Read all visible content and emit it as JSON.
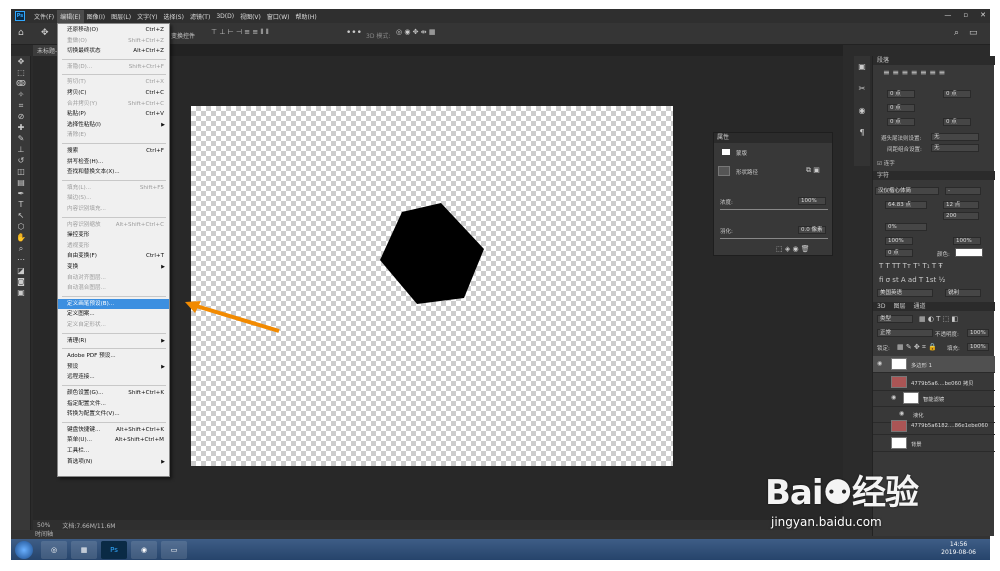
{
  "app": {
    "logo": "Ps"
  },
  "menu": [
    "文件(F)",
    "编辑(E)",
    "图像(I)",
    "图层(L)",
    "文字(Y)",
    "选择(S)",
    "滤镜(T)",
    "3D(D)",
    "视图(V)",
    "窗口(W)",
    "帮助(H)"
  ],
  "window_controls": [
    "—",
    "▫",
    "✕"
  ],
  "options_bar": {
    "label": "变换控件",
    "mode": "3D 模式:"
  },
  "doc_tab": {
    "title": "未标题-"
  },
  "status": {
    "zoom": "50%",
    "doc": "文档:7.66M/11.6M"
  },
  "timeline": {
    "label": "时间轴"
  },
  "edit_menu": [
    {
      "label": "还原移动(O)",
      "shortcut": "Ctrl+Z",
      "disabled": false
    },
    {
      "label": "重做(O)",
      "shortcut": "Shift+Ctrl+Z",
      "disabled": true
    },
    {
      "label": "切换最终状态",
      "shortcut": "Alt+Ctrl+Z",
      "disabled": false
    },
    {
      "sep": true
    },
    {
      "label": "渐隐(D)...",
      "shortcut": "Shift+Ctrl+F",
      "disabled": true
    },
    {
      "sep": true
    },
    {
      "label": "剪切(T)",
      "shortcut": "Ctrl+X",
      "disabled": true
    },
    {
      "label": "拷贝(C)",
      "shortcut": "Ctrl+C",
      "disabled": false
    },
    {
      "label": "合并拷贝(Y)",
      "shortcut": "Shift+Ctrl+C",
      "disabled": true
    },
    {
      "label": "粘贴(P)",
      "shortcut": "Ctrl+V",
      "disabled": false
    },
    {
      "label": "选择性粘贴(I)",
      "submenu": true,
      "disabled": false
    },
    {
      "label": "清除(E)",
      "disabled": true
    },
    {
      "sep": true
    },
    {
      "label": "搜索",
      "shortcut": "Ctrl+F",
      "disabled": false
    },
    {
      "label": "拼写检查(H)...",
      "disabled": false
    },
    {
      "label": "查找和替换文本(X)...",
      "disabled": false
    },
    {
      "sep": true
    },
    {
      "label": "填充(L)...",
      "shortcut": "Shift+F5",
      "disabled": true
    },
    {
      "label": "描边(S)...",
      "disabled": true
    },
    {
      "label": "内容识别填充...",
      "disabled": true
    },
    {
      "sep": true
    },
    {
      "label": "内容识别缩放",
      "shortcut": "Alt+Shift+Ctrl+C",
      "disabled": true
    },
    {
      "label": "操控变形",
      "disabled": false
    },
    {
      "label": "透视变形",
      "disabled": true
    },
    {
      "label": "自由变换(F)",
      "shortcut": "Ctrl+T",
      "disabled": false
    },
    {
      "label": "变换",
      "submenu": true,
      "disabled": false
    },
    {
      "label": "自动对齐图层...",
      "disabled": true
    },
    {
      "label": "自动混合图层...",
      "disabled": true
    },
    {
      "sep": true
    },
    {
      "label": "定义画笔预设(B)...",
      "disabled": false,
      "highlight": true
    },
    {
      "label": "定义图案...",
      "disabled": false
    },
    {
      "label": "定义自定形状...",
      "disabled": true
    },
    {
      "sep": true
    },
    {
      "label": "清理(R)",
      "submenu": true,
      "disabled": false
    },
    {
      "sep": true
    },
    {
      "label": "Adobe PDF 预设...",
      "disabled": false
    },
    {
      "label": "预设",
      "submenu": true,
      "disabled": false
    },
    {
      "label": "远程连接...",
      "disabled": false
    },
    {
      "sep": true
    },
    {
      "label": "颜色设置(G)...",
      "shortcut": "Shift+Ctrl+K",
      "disabled": false
    },
    {
      "label": "指定配置文件...",
      "disabled": false
    },
    {
      "label": "转换为配置文件(V)...",
      "disabled": false
    },
    {
      "sep": true
    },
    {
      "label": "键盘快捷键...",
      "shortcut": "Alt+Shift+Ctrl+K",
      "disabled": false
    },
    {
      "label": "菜单(U)...",
      "shortcut": "Alt+Shift+Ctrl+M",
      "disabled": false
    },
    {
      "label": "工具栏...",
      "disabled": false
    },
    {
      "label": "首选项(N)",
      "submenu": true,
      "disabled": false
    }
  ],
  "properties": {
    "title": "属性",
    "tab": "蒙版",
    "shape_path": "形状路径",
    "density_label": "浓度:",
    "density": "100%",
    "feather_label": "羽化:",
    "feather": "0.0 像素"
  },
  "paragraph": {
    "title": "段落",
    "f1": "0 点",
    "f2": "0 点",
    "f3": "0 点",
    "f4": "0 点",
    "f5": "0 点",
    "hyph_label": "避头尾法则设置:",
    "hyph": "无",
    "spacing_label": "间距组合设置:",
    "spacing": "无",
    "hyphenate": "连字"
  },
  "character": {
    "title": "字符",
    "font": "汉仪楷心体简",
    "size": "64.83 点",
    "leading": "12 点",
    "tracking": "200",
    "kern": "0%",
    "scale_v": "100%",
    "scale_h": "100%",
    "baseline": "0 点",
    "color_label": "颜色:",
    "lang": "美国英语",
    "aa": "锐利"
  },
  "layers": {
    "tabs": [
      "3D",
      "图层",
      "通道"
    ],
    "kind": "类型",
    "blend": "正常",
    "opacity_label": "不透明度:",
    "opacity": "100%",
    "lock_label": "锁定:",
    "fill_label": "填充:",
    "fill": "100%",
    "items": [
      {
        "name": "多边形 1"
      },
      {
        "name": "4779b5a6....be060 拷贝"
      },
      {
        "name": "智能滤镜"
      },
      {
        "name": "液化"
      },
      {
        "name": "4779b5a6182....86e1ebe060"
      },
      {
        "name": "背景"
      }
    ]
  },
  "taskbar": {
    "time": "14:56",
    "date": "2019-08-06"
  },
  "watermark": {
    "brand": "Bai⚉经验",
    "url": "jingyan.baidu.com"
  }
}
